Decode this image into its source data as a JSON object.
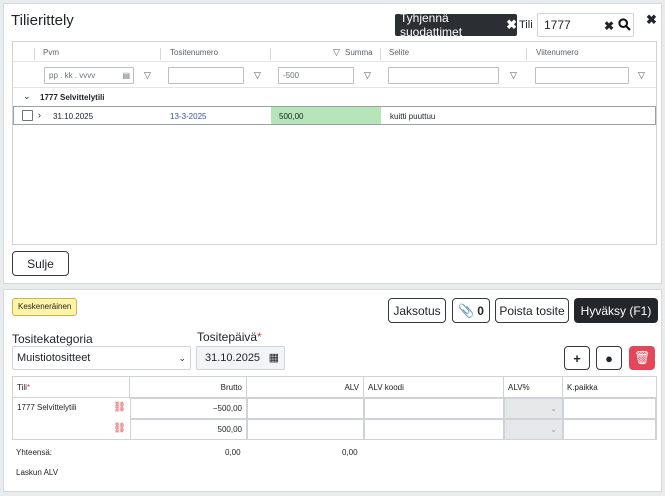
{
  "dialog": {
    "title": "Tilierittely",
    "clear_filters": "Tyhjennä suodattimet",
    "tili_label": "Tili",
    "tili_value": "1777",
    "columns": [
      "Pvm",
      "Tositenumero",
      "Summa",
      "Selite",
      "Viitenumero"
    ],
    "filters": {
      "date_placeholder": "pp . kk . vvvv",
      "summa": "-500"
    },
    "group": "1777 Selvittelytili",
    "row": {
      "date": "31.10.2025",
      "voucher": "13-3-2025",
      "sum": "500,00",
      "desc": "kuitti puuttuu"
    },
    "close_label": "Sulje"
  },
  "panel": {
    "status": "Keskeneräinen",
    "buttons": {
      "jaksotus": "Jaksotus",
      "attachments": "0",
      "delete": "Poista tosite",
      "approve": "Hyväksy (F1)"
    },
    "category_label": "Tositekategoria",
    "category_value": "Muistiotositteet",
    "date_label": "Tositepäivä",
    "date_value": "31.10.2025",
    "headers": {
      "tili": "Tili",
      "brutto": "Brutto",
      "alv": "ALV",
      "alv_koodi": "ALV koodi",
      "alv_pct": "ALV%",
      "kpaikka": "K.paikka"
    },
    "lines": [
      {
        "account": "1777 Selvittelytili",
        "brutto": "−500,00"
      },
      {
        "account": "",
        "brutto": "500,00"
      }
    ],
    "totals_label": "Yhteensä:",
    "total_brutto": "0,00",
    "total_alv": "0,00",
    "invoice_vat": "Laskun ALV"
  },
  "colors": {
    "sum_highlight": "#b5e5b9",
    "approve_bg": "#23272b",
    "delete_bg": "#e4475a",
    "status_bg": "#fff3a6"
  }
}
